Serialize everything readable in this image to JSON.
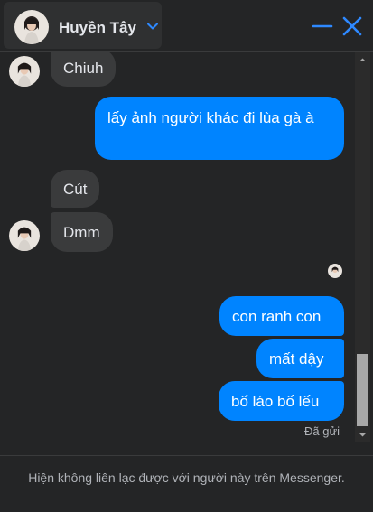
{
  "header": {
    "contact_name": "Huyền Tây",
    "accent_color": "#0084ff",
    "icons": [
      "avatar",
      "chevron-down-icon",
      "minimize-icon",
      "close-icon"
    ]
  },
  "messages": [
    {
      "direction": "incoming",
      "text": "Chiuh",
      "show_avatar": true
    },
    {
      "direction": "outgoing",
      "text": "lấy ảnh người khác đi lùa gà à"
    },
    {
      "direction": "incoming",
      "text": "Cút",
      "show_avatar": false
    },
    {
      "direction": "incoming",
      "text": "Dmm",
      "show_avatar": true
    },
    {
      "direction": "outgoing",
      "text": "con ranh con"
    },
    {
      "direction": "outgoing",
      "text": "mất dậy"
    },
    {
      "direction": "outgoing",
      "text": "bố láo bố lếu"
    }
  ],
  "status": {
    "sent_label": "Đã gửi"
  },
  "footer": {
    "notice": "Hiện không liên lạc được với người này trên Messenger."
  },
  "colors": {
    "background": "#242526",
    "incoming_bubble": "#3a3b3c",
    "outgoing_bubble": "#0084ff",
    "text": "#e4e6eb",
    "muted_text": "#b0b3b8"
  }
}
